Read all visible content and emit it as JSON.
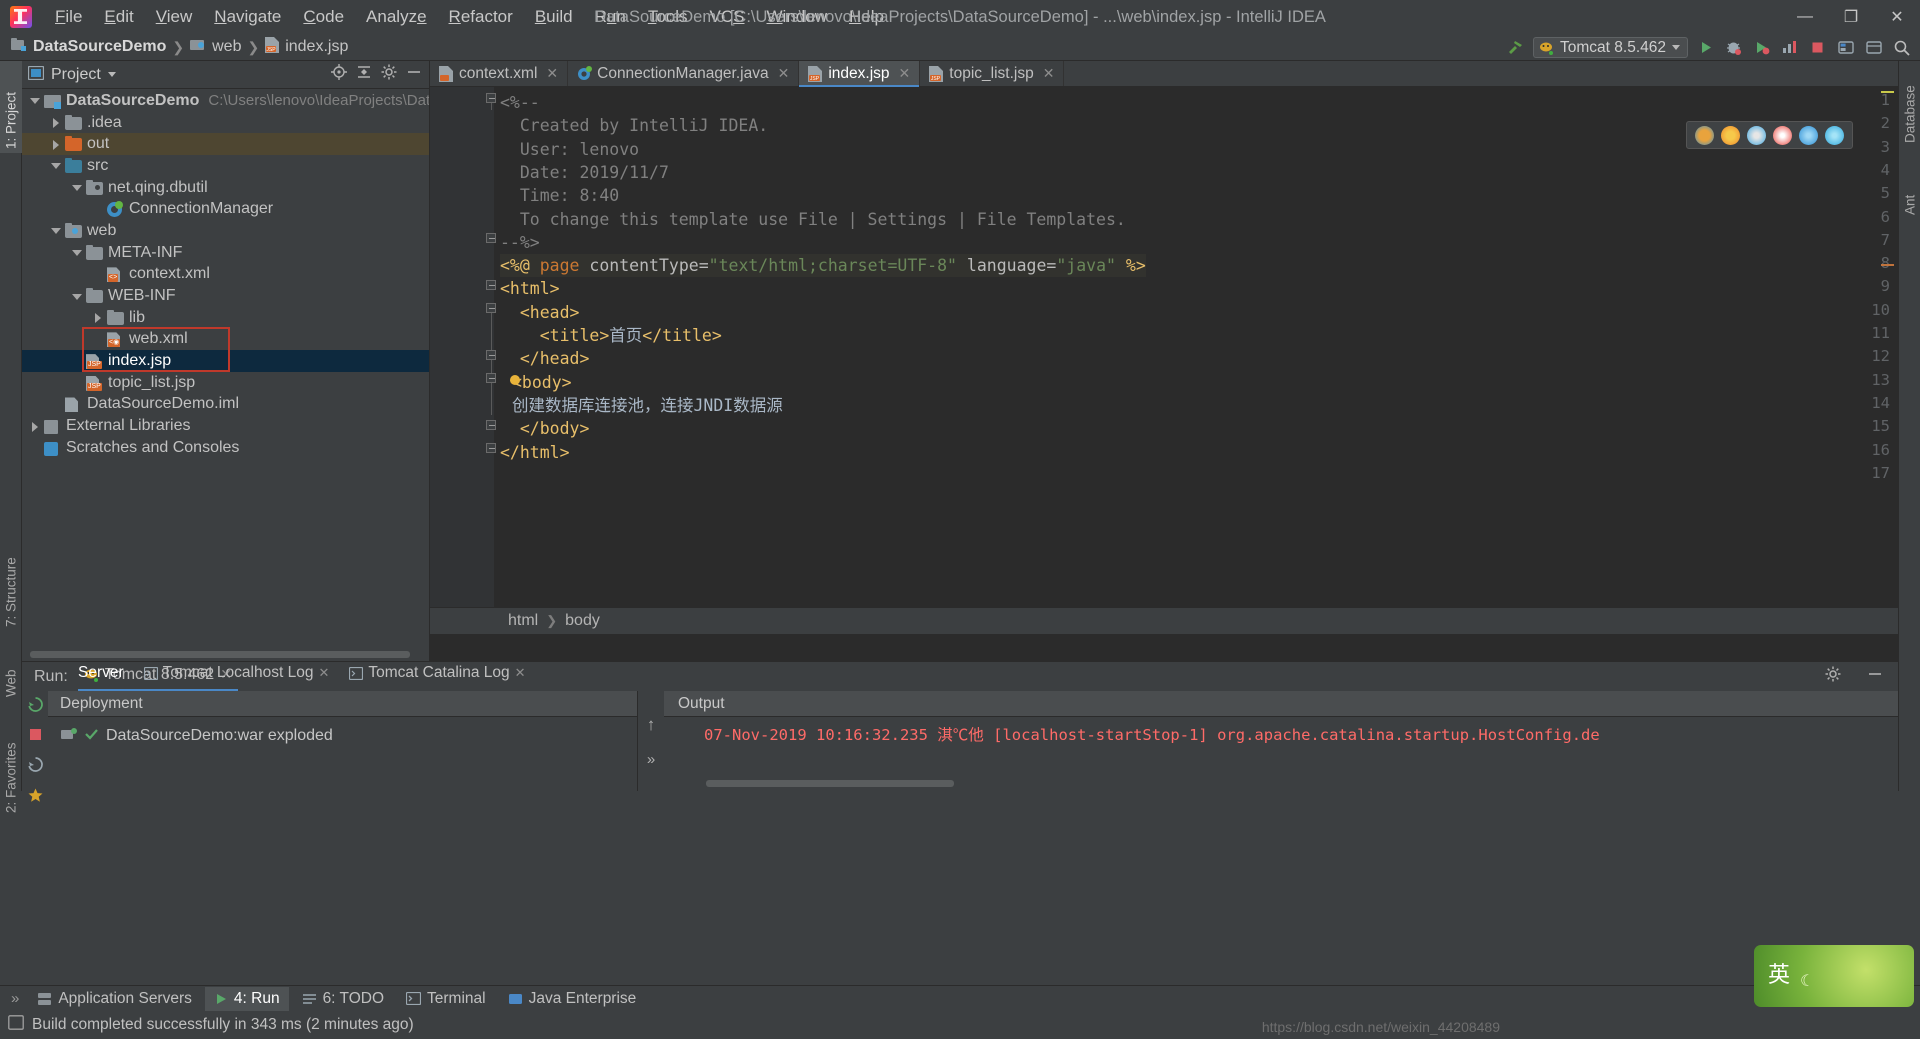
{
  "app": {
    "window_title": "DataSourceDemo [C:\\Users\\lenovo\\IdeaProjects\\DataSourceDemo] - ...\\web\\index.jsp - IntelliJ IDEA",
    "logo_icon": "intellij-idea-logo"
  },
  "menu": {
    "items": [
      {
        "label": "File"
      },
      {
        "label": "Edit"
      },
      {
        "label": "View"
      },
      {
        "label": "Navigate"
      },
      {
        "label": "Code"
      },
      {
        "label": "Analyze"
      },
      {
        "label": "Refactor"
      },
      {
        "label": "Build"
      },
      {
        "label": "Run"
      },
      {
        "label": "Tools"
      },
      {
        "label": "VCS"
      },
      {
        "label": "Window"
      },
      {
        "label": "Help"
      }
    ],
    "window_controls": {
      "minimize": "—",
      "maximize": "❐",
      "close": "✕"
    }
  },
  "breadcrumb_nav": {
    "items": [
      {
        "label": "DataSourceDemo",
        "icon": "module-icon"
      },
      {
        "label": "web",
        "icon": "web-folder-icon"
      },
      {
        "label": "index.jsp",
        "icon": "jsp-file-icon"
      }
    ],
    "separator": "❯"
  },
  "toolbar": {
    "build_icon": "hammer-icon",
    "run_config": {
      "label": "Tomcat 8.5.462",
      "icon": "tomcat-icon"
    },
    "actions": [
      {
        "name": "run-button",
        "icon": "run-green-arrow"
      },
      {
        "name": "debug-button",
        "icon": "debug-bug-icon"
      },
      {
        "name": "run-coverage-button",
        "icon": "coverage-icon"
      },
      {
        "name": "profile-button",
        "icon": "profiler-icon"
      },
      {
        "name": "stop-button",
        "icon": "stop-square-icon"
      },
      {
        "name": "update-app-button",
        "icon": "update-icon"
      },
      {
        "name": "layout-button",
        "icon": "layout-icon"
      },
      {
        "name": "search-everywhere-button",
        "icon": "search-icon"
      }
    ]
  },
  "left_tool_strip": [
    {
      "label": "1: Project",
      "selected": true,
      "icon": "project-icon"
    },
    {
      "label": "7: Structure",
      "selected": false,
      "icon": "structure-icon"
    },
    {
      "label": "Web",
      "selected": false,
      "icon": "web-icon"
    },
    {
      "label": "2: Favorites",
      "selected": false,
      "icon": "favorites-star-icon"
    }
  ],
  "right_tool_strip": [
    {
      "label": "Database",
      "icon": "database-icon"
    },
    {
      "label": "Ant",
      "icon": "ant-icon"
    }
  ],
  "project_panel": {
    "title": "Project",
    "header_icons": [
      "locate-target-icon",
      "collapse-all-icon",
      "settings-gear-icon",
      "hide-minus-icon"
    ],
    "tree": [
      {
        "label": "DataSourceDemo",
        "detail": "C:\\Users\\lenovo\\IdeaProjects\\DataSourceD",
        "indent": 0,
        "arrow": "down",
        "icon": "module-icon",
        "bold": true
      },
      {
        "label": ".idea",
        "indent": 1,
        "arrow": "right",
        "icon": "folder-icon"
      },
      {
        "label": "out",
        "indent": 1,
        "arrow": "right",
        "icon": "folder-out-icon",
        "highlight": true
      },
      {
        "label": "src",
        "indent": 1,
        "arrow": "down",
        "icon": "folder-source-icon"
      },
      {
        "label": "net.qing.dbutil",
        "indent": 2,
        "arrow": "down",
        "icon": "package-icon"
      },
      {
        "label": "ConnectionManager",
        "indent": 3,
        "arrow": "none",
        "icon": "java-class-icon"
      },
      {
        "label": "web",
        "indent": 1,
        "arrow": "down",
        "icon": "web-folder-icon"
      },
      {
        "label": "META-INF",
        "indent": 2,
        "arrow": "down",
        "icon": "folder-icon"
      },
      {
        "label": "context.xml",
        "indent": 3,
        "arrow": "none",
        "icon": "xml-file-icon"
      },
      {
        "label": "WEB-INF",
        "indent": 2,
        "arrow": "down",
        "icon": "folder-icon"
      },
      {
        "label": "lib",
        "indent": 3,
        "arrow": "right",
        "icon": "folder-icon"
      },
      {
        "label": "web.xml",
        "indent": 3,
        "arrow": "none",
        "icon": "web-xml-file-icon"
      },
      {
        "label": "index.jsp",
        "indent": 2,
        "arrow": "none",
        "icon": "jsp-file-icon",
        "selected": true
      },
      {
        "label": "topic_list.jsp",
        "indent": 2,
        "arrow": "none",
        "icon": "jsp-file-icon"
      },
      {
        "label": "DataSourceDemo.iml",
        "indent": 1,
        "arrow": "none",
        "icon": "iml-file-icon"
      },
      {
        "label": "External Libraries",
        "indent": 0,
        "arrow": "right",
        "icon": "libraries-icon"
      },
      {
        "label": "Scratches and Consoles",
        "indent": 0,
        "arrow": "none",
        "icon": "scratches-icon"
      }
    ]
  },
  "editor": {
    "tabs": [
      {
        "label": "context.xml",
        "icon": "xml-file-icon",
        "active": false,
        "close": "✕"
      },
      {
        "label": "ConnectionManager.java",
        "icon": "java-class-icon",
        "active": false,
        "close": "✕"
      },
      {
        "label": "index.jsp",
        "icon": "jsp-file-icon",
        "active": true,
        "close": "✕"
      },
      {
        "label": "topic_list.jsp",
        "icon": "jsp-file-icon",
        "active": false,
        "close": "✕"
      }
    ],
    "line_numbers": [
      "1",
      "2",
      "3",
      "4",
      "5",
      "6",
      "7",
      "8",
      "9",
      "10",
      "11",
      "12",
      "13",
      "14",
      "15",
      "16",
      "17"
    ],
    "lines": [
      {
        "n": 1,
        "segments": [
          {
            "t": "<%--",
            "c": "cm"
          }
        ]
      },
      {
        "n": 2,
        "segments": [
          {
            "t": "  Created by IntelliJ IDEA.",
            "c": "cm"
          }
        ]
      },
      {
        "n": 3,
        "segments": [
          {
            "t": "  User: lenovo",
            "c": "cm"
          }
        ]
      },
      {
        "n": 4,
        "segments": [
          {
            "t": "  Date: 2019/11/7",
            "c": "cm"
          }
        ]
      },
      {
        "n": 5,
        "segments": [
          {
            "t": "  Time: 8:40",
            "c": "cm"
          }
        ]
      },
      {
        "n": 6,
        "segments": [
          {
            "t": "  To change this template use File | Settings | File Templates.",
            "c": "cm"
          }
        ]
      },
      {
        "n": 7,
        "segments": [
          {
            "t": "--%>",
            "c": "cm"
          }
        ]
      },
      {
        "n": 8,
        "segments": [
          {
            "t": "<%@ ",
            "c": "tag"
          },
          {
            "t": "page ",
            "c": "kw"
          },
          {
            "t": "contentType=",
            "c": "att"
          },
          {
            "t": "\"text/html;charset=UTF-8\"",
            "c": "str"
          },
          {
            "t": " language=",
            "c": "att"
          },
          {
            "t": "\"java\"",
            "c": "str"
          },
          {
            "t": " %>",
            "c": "tag"
          }
        ]
      },
      {
        "n": 9,
        "segments": [
          {
            "t": "<html>",
            "c": "tag"
          }
        ]
      },
      {
        "n": 10,
        "segments": [
          {
            "t": "  <head>",
            "c": "tag"
          }
        ]
      },
      {
        "n": 11,
        "segments": [
          {
            "t": "    <title>",
            "c": "tag"
          },
          {
            "t": "首页",
            "c": "txt"
          },
          {
            "t": "</title>",
            "c": "tag"
          }
        ]
      },
      {
        "n": 12,
        "segments": [
          {
            "t": "  </head>",
            "c": "tag"
          }
        ]
      },
      {
        "n": 13,
        "segments": [
          {
            "t": "<body>",
            "c": "tag"
          }
        ]
      },
      {
        "n": 14,
        "segments": [
          {
            "t": "创建数据库连接池，连接JNDI数据源",
            "c": "txt"
          }
        ]
      },
      {
        "n": 15,
        "segments": [
          {
            "t": "  </body>",
            "c": "tag"
          }
        ]
      },
      {
        "n": 16,
        "segments": [
          {
            "t": "</html>",
            "c": "tag"
          }
        ]
      },
      {
        "n": 17,
        "segments": [
          {
            "t": "",
            "c": "txt"
          }
        ]
      }
    ],
    "breadcrumbs": [
      "html",
      "body"
    ],
    "breadcrumb_separator": "❯",
    "browser_popup": {
      "icons": [
        "chrome-icon",
        "firefox-icon",
        "safari-icon",
        "opera-icon",
        "edge-legacy-icon",
        "edge-icon"
      ],
      "colors": [
        "#e8a33d",
        "#f0862c",
        "#3ea7e0",
        "#e8443c",
        "#2e8fd4",
        "#2fa8dd"
      ]
    }
  },
  "run_panel": {
    "label": "Run:",
    "config": {
      "label": "Tomcat 8.5.462",
      "icon": "tomcat-icon",
      "close": "✕"
    },
    "header_icons": [
      "settings-gear-icon",
      "hide-minus-icon"
    ],
    "side_actions": [
      "rerun-icon",
      "stop-icon",
      "restart-icon",
      "thread-dump-icon"
    ],
    "sub_tabs": [
      {
        "label": "Server",
        "selected": true,
        "icon": ""
      },
      {
        "label": "Tomcat Localhost Log",
        "selected": false,
        "icon": "console-icon",
        "close": "✕"
      },
      {
        "label": "Tomcat Catalina Log",
        "selected": false,
        "icon": "console-icon",
        "close": "✕"
      }
    ],
    "deployment": {
      "header": "Deployment",
      "rows": [
        {
          "label": "DataSourceDemo:war exploded",
          "status": "check-green",
          "icon": "artifact-icon"
        }
      ],
      "arrows": [
        "↑",
        "»"
      ]
    },
    "output": {
      "header": "Output",
      "lines": [
        "07-Nov-2019 10:16:32.235 淇℃他 [localhost-startStop-1] org.apache.catalina.startup.HostConfig.de"
      ],
      "color": "#ff6b68"
    }
  },
  "bottom_tabs": [
    {
      "label": "Application Servers",
      "selected": false,
      "icon": "server-icon"
    },
    {
      "label": "4: Run",
      "selected": true,
      "icon": "run-green-arrow"
    },
    {
      "label": "6: TODO",
      "selected": false,
      "icon": "todo-icon"
    },
    {
      "label": "Terminal",
      "selected": false,
      "icon": "terminal-icon"
    },
    {
      "label": "Java Enterprise",
      "selected": false,
      "icon": "java-ee-icon"
    }
  ],
  "status_bar": {
    "message": "Build completed successfully in 343 ms (2 minutes ago)",
    "icon": "event-log-icon",
    "watermark": "https://blog.csdn.net/weixin_44208489"
  },
  "ime_widget": {
    "text": "英",
    "moon": "☾"
  },
  "colors": {
    "bg": "#3c3f41",
    "editor_bg": "#2b2b2b",
    "selection": "#0d293e",
    "accent": "#4a88c7",
    "annotation_red": "#c0392b",
    "error_text": "#ff6b68",
    "tag": "#e8bf6a",
    "keyword": "#cc7832",
    "string": "#6a8759",
    "comment": "#808080"
  }
}
